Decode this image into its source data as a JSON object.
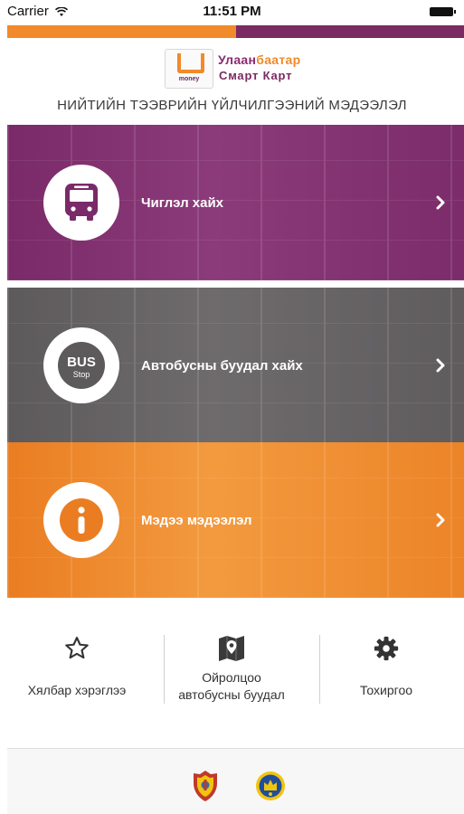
{
  "status_bar": {
    "carrier": "Carrier",
    "time": "11:51 PM"
  },
  "progress": {
    "fraction": 0.5
  },
  "brand": {
    "logo_word": "money",
    "name_part1": "Улаан",
    "name_part2": "баатар",
    "line2": "Смарт Карт",
    "subtitle": "НИЙТИЙН ТЭЭВРИЙН ҮЙЛЧИЛГЭЭНИЙ МЭДЭЭЛЭЛ"
  },
  "menu": {
    "route": {
      "label": "Чиглэл хайх",
      "icon": "bus-icon"
    },
    "bus_stop": {
      "label": "Автобусны буудал хайх",
      "icon": "bus-stop-icon",
      "badge_top": "BUS",
      "badge_bottom": "Stop"
    },
    "info": {
      "label": "Мэдээ мэдээлэл",
      "icon": "info-icon"
    }
  },
  "bottom_nav": {
    "favorites": {
      "label": "Хялбар хэрэглээ",
      "icon": "star-icon"
    },
    "nearby": {
      "label_line1": "Ойролцоо",
      "label_line2": "автобусны буудал",
      "icon": "map-pin-icon"
    },
    "settings": {
      "label": "Тохиргоо",
      "icon": "gear-icon"
    }
  },
  "colors": {
    "purple": "#7a2a68",
    "gray": "#5d5a5c",
    "orange": "#ea7d22",
    "accent_orange": "#f08a2a"
  }
}
